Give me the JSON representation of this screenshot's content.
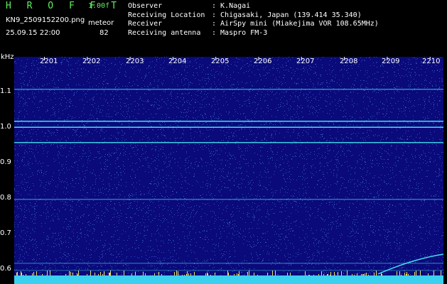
{
  "header": {
    "brand": "H R O F F T",
    "version": "1.00f",
    "filename": "KN9_2509152200.png",
    "meteor_label": "meteor",
    "datetime": "25.09.15 22:00",
    "meteor_count": "82",
    "info": [
      {
        "key": "Observer",
        "value": ": K.Nagai"
      },
      {
        "key": "Receiving Location",
        "value": ": Chigasaki, Japan (139.414 35.340)"
      },
      {
        "key": "Receiver",
        "value": ": AirSpy mini (Miakejima VOR 108.65MHz)"
      },
      {
        "key": "Receiving antenna",
        "value": ": Maspro FM-3"
      }
    ]
  },
  "chart_data": {
    "type": "heatmap",
    "ylabel": "kHz",
    "yticks": [
      "1.1",
      "1.0",
      "0.9",
      "0.8",
      "0.7",
      "0.6"
    ],
    "xticks": [
      "2201",
      "2202",
      "2203",
      "2204",
      "2205",
      "2206",
      "2207",
      "2208",
      "2209",
      "2210"
    ],
    "colors": {
      "background": "#0a0a7a",
      "noise": "#3d6ad0",
      "signal": "#40e0f0",
      "band": "#3ad0f0",
      "spike": "#f0e060"
    }
  }
}
